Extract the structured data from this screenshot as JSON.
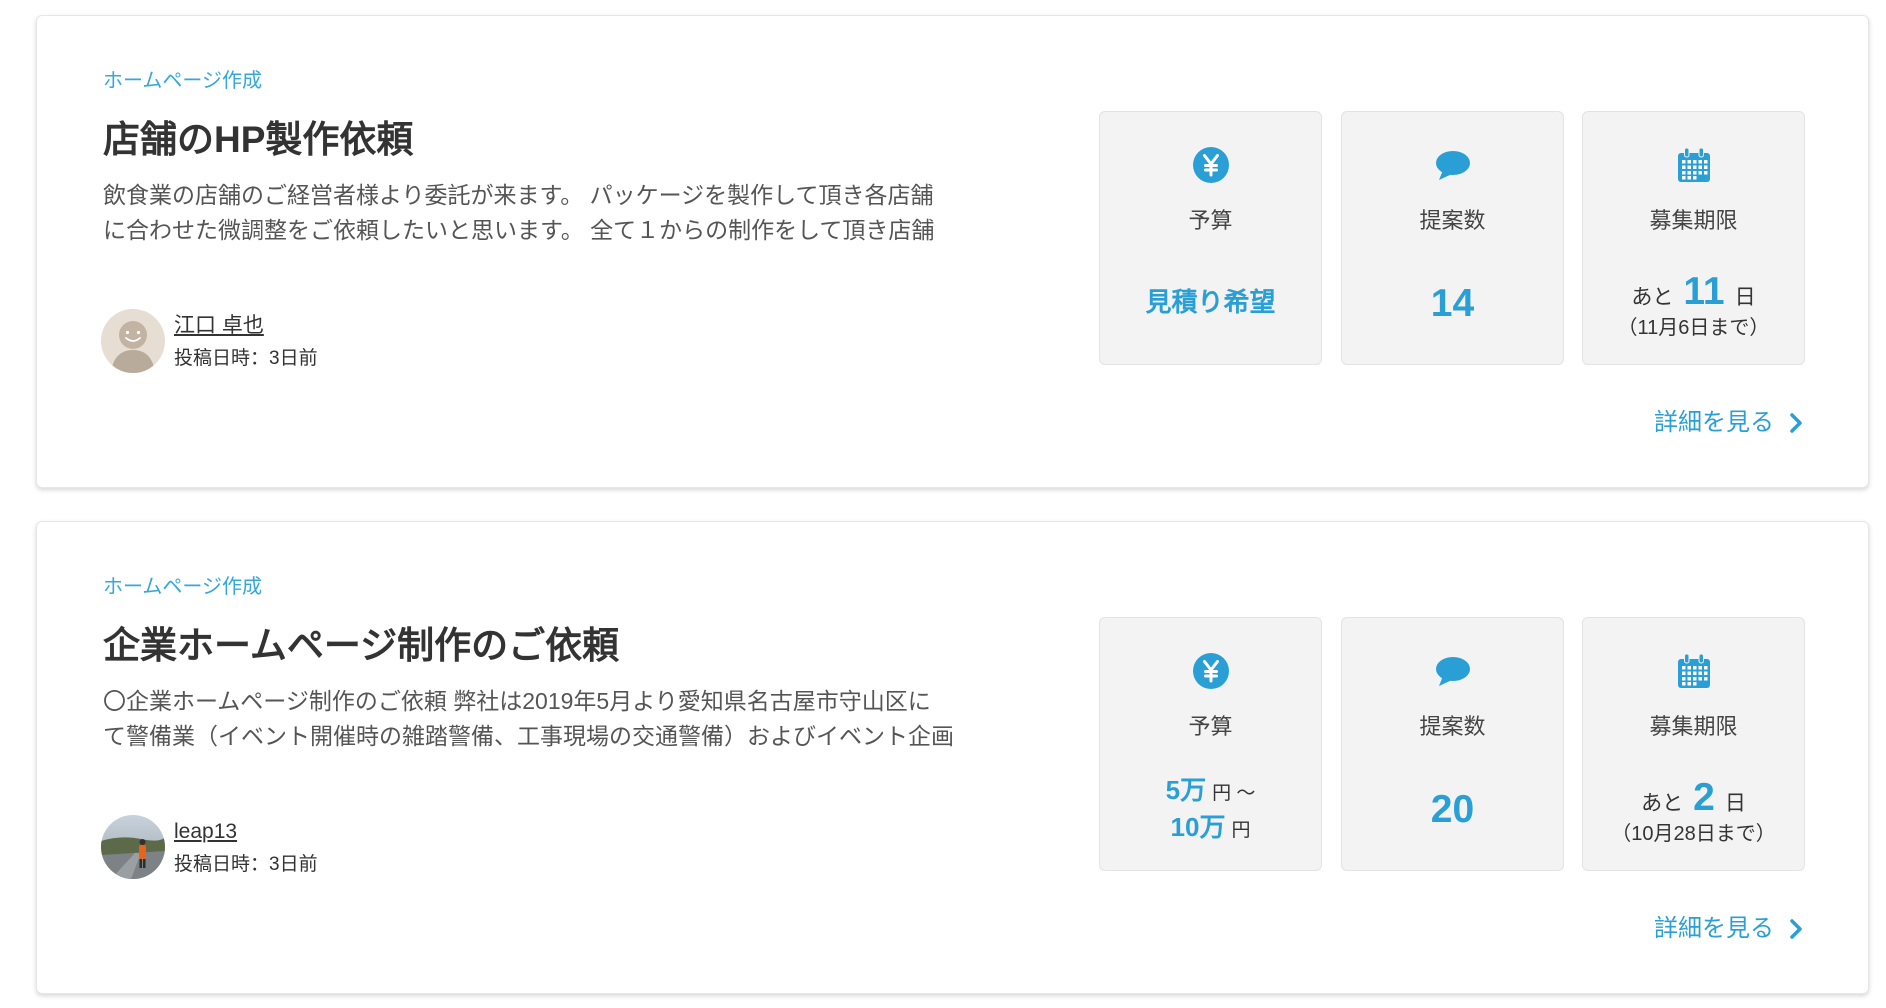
{
  "colors": {
    "accent": "#2a9fd6",
    "category": "#34a7dc",
    "text": "#333333",
    "muted": "#555555",
    "stat_background": "#f3f3f3"
  },
  "projects": [
    {
      "category": "ホームページ作成",
      "title": "店舗のHP製作依頼",
      "description_lines": [
        "飲食業の店舗のご経営者様より委託が来ます。 パッケージを製作して頂き各店舗",
        "に合わせた微調整をご依頼したいと思います。 全て１からの制作をして頂き店舗"
      ],
      "author": {
        "name": "江口 卓也",
        "posted": "投稿日時：3日前",
        "avatar": "default-user-avatar"
      },
      "budget": {
        "icon": "yen-icon",
        "label": "予算",
        "text": "見積り希望"
      },
      "proposals": {
        "icon": "speech-bubble-icon",
        "label": "提案数",
        "count": 14
      },
      "deadline": {
        "icon": "calendar-icon",
        "label": "募集期限",
        "prefix": "あと",
        "days": 11,
        "suffix": "日",
        "date": "（11月6日まで）"
      },
      "detail_link": {
        "label": "詳細を見る",
        "icon": "chevron-right-icon"
      }
    },
    {
      "category": "ホームページ作成",
      "title": "企業ホームページ制作のご依頼",
      "description_lines": [
        "〇企業ホームページ制作のご依頼 弊社は2019年5月より愛知県名古屋市守山区に",
        "て警備業（イベント開催時の雑踏警備、工事現場の交通警備）およびイベント企画"
      ],
      "author": {
        "name": "leap13",
        "posted": "投稿日時：3日前",
        "avatar": "user-photo-avatar"
      },
      "budget": {
        "icon": "yen-icon",
        "label": "予算",
        "min": "5万",
        "min_unit": "円 ～",
        "max": "10万",
        "max_unit": "円"
      },
      "proposals": {
        "icon": "speech-bubble-icon",
        "label": "提案数",
        "count": 20
      },
      "deadline": {
        "icon": "calendar-icon",
        "label": "募集期限",
        "prefix": "あと",
        "days": 2,
        "suffix": "日",
        "date": "（10月28日まで）"
      },
      "detail_link": {
        "label": "詳細を見る",
        "icon": "chevron-right-icon"
      }
    }
  ]
}
